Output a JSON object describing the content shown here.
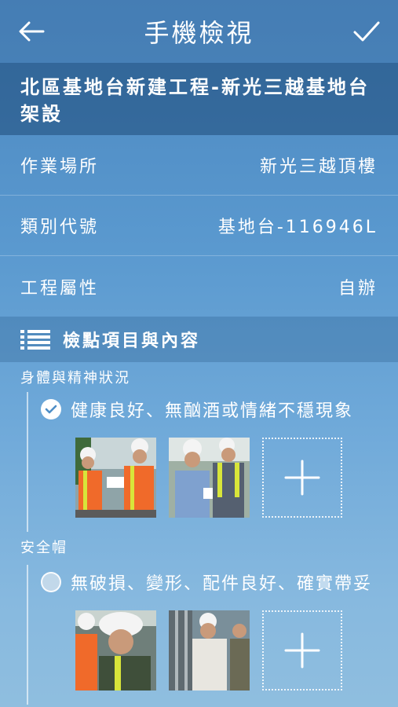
{
  "header": {
    "title": "手機檢視",
    "back_icon": "arrow-left-icon",
    "confirm_icon": "checkmark-icon"
  },
  "project": {
    "title": "北區基地台新建工程-新光三越基地台架設"
  },
  "info": [
    {
      "label": "作業場所",
      "value": "新光三越頂樓"
    },
    {
      "label": "類別代號",
      "value": "基地台-116946L"
    },
    {
      "label": "工程屬性",
      "value": "自辦"
    }
  ],
  "section": {
    "title": "檢點項目與內容",
    "icon": "list-icon"
  },
  "groups": [
    {
      "category": "身體與精神狀況",
      "item": "健康良好、無酗酒或情緒不穩現象",
      "checked": true
    },
    {
      "category": "安全帽",
      "item": "無破損、變形、配件良好、確實帶妥",
      "checked": false
    }
  ],
  "colors": {
    "header_bg": "#3c6ea0",
    "title_bg": "#1e4b78",
    "vest_orange": "#f06a2a",
    "vest_yellow": "#d8e53a"
  }
}
